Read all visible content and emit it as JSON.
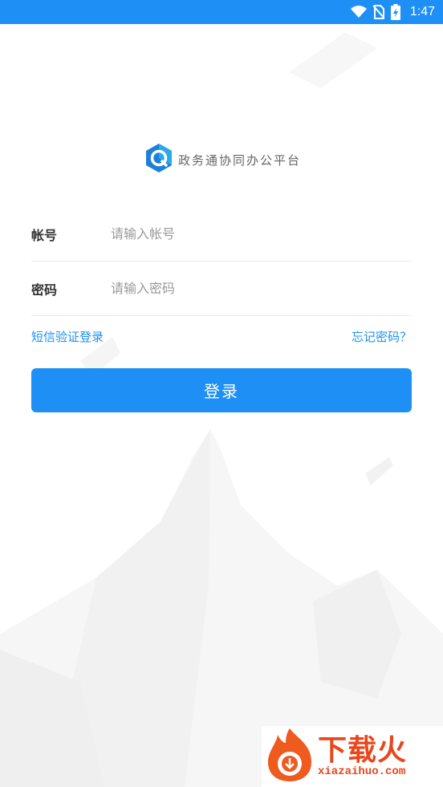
{
  "status_bar": {
    "time": "1:47"
  },
  "app": {
    "title": "政务通协同办公平台"
  },
  "form": {
    "account_label": "帐号",
    "account_placeholder": "请输入帐号",
    "password_label": "密码",
    "password_placeholder": "请输入密码"
  },
  "links": {
    "sms_login": "短信验证登录",
    "forgot_password": "忘记密码？"
  },
  "login_button": "登录",
  "watermark": {
    "brand": "下载火",
    "url": "xiazaihuo.com"
  },
  "colors": {
    "accent": "#1e90f5",
    "watermark": "#e8471c"
  }
}
